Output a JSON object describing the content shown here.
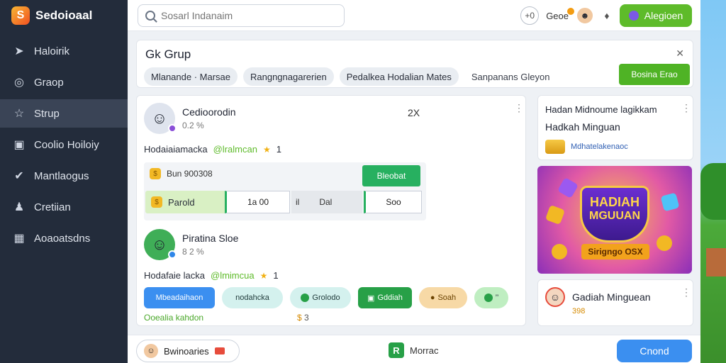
{
  "app": {
    "name": "Sedoioaal"
  },
  "sidebar": {
    "items": [
      {
        "label": "Haloirik",
        "icon": "pin-icon"
      },
      {
        "label": "Graop",
        "icon": "target-icon"
      },
      {
        "label": "Strup",
        "icon": "star-icon"
      },
      {
        "label": "Coolio Hoiloiy",
        "icon": "folder-icon"
      },
      {
        "label": "Mantlaogus",
        "icon": "bird-icon"
      },
      {
        "label": "Cretiian",
        "icon": "person-icon"
      },
      {
        "label": "Aoaoatsdns",
        "icon": "grid-icon"
      }
    ]
  },
  "topbar": {
    "search_placeholder": "Sosarl Indanaim",
    "circle_label": "+0",
    "mid_label": "Geoe",
    "register_label": "Alegioen"
  },
  "group": {
    "title": "Gk Grup",
    "chips": [
      "Mlanande · Marsae",
      "Rangngnagarerien",
      "Pedalkea Hodalian Mates"
    ],
    "plain_chip": "Sanpanans Gleyon",
    "action_label": "Bosina Erao"
  },
  "feed": {
    "post1": {
      "name": "Cedioorodin",
      "sub": "0.2 %",
      "count": "2X",
      "line": "Hodaiaiamacka",
      "mention": "@lralmcan",
      "rating": "1",
      "form_label": "Bun 900308",
      "ok_label": "Bleobat",
      "field_label": "Parold",
      "input_value": "1a 00",
      "gray_a": "il",
      "gray_b": "Dal",
      "input2_value": "Soo"
    },
    "post2": {
      "name": "Piratina Sloe",
      "sub": "8 2 %",
      "line": "Hodafaie lacka",
      "mention": "@lmimcua",
      "rating": "1"
    },
    "actions": [
      "Mbeadaihaon",
      "nodahcka",
      "Grolodo",
      "Gddiah",
      "Soah",
      "’’"
    ],
    "foot_note": "Ooealia kahdon",
    "foot_val": "3"
  },
  "right": {
    "promo_title": "Hadan Midnoume lagikkam",
    "promo_sub": "Hadkah Minguan",
    "promo_line": "Mdhatelakenaoc",
    "banner_line1": "HADIAH",
    "banner_line2": "MGUUAN",
    "banner_ribbon": "Sirigngo OSX",
    "reward_title": "Gadiah Minguean",
    "reward_val": "398"
  },
  "bottombar": {
    "user_label": "Bwinoaries",
    "center_label": "Morrac",
    "button_label": "Cnond"
  }
}
